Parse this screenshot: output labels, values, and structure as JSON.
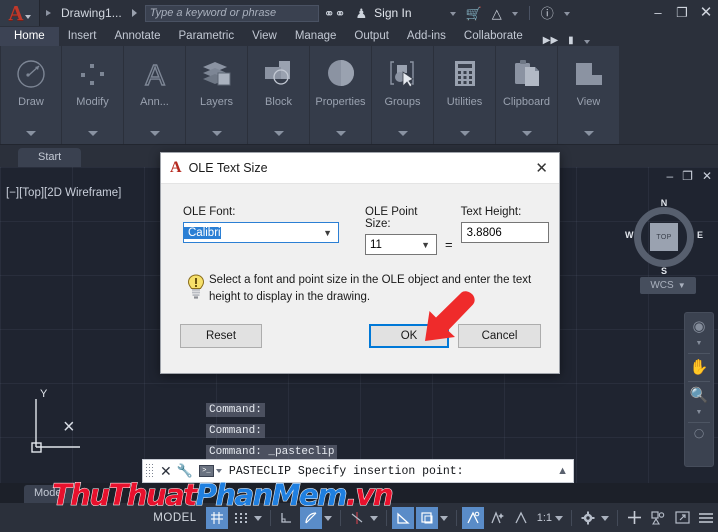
{
  "titlebar": {
    "app_logo": "autocad-a-logo",
    "document_title": "Drawing1...",
    "search_placeholder": "Type a keyword or phrase",
    "search_value": "",
    "search_icon": "binoculars-icon",
    "signin_label": "Sign In",
    "account_icon": "person-icon",
    "cart_icon": "shopping-cart-icon",
    "autodesk_icon": "autodesk-triangle-icon",
    "help_icon": "question-circle-icon",
    "minimize": "–",
    "maximize": "❐",
    "close": "✕"
  },
  "ribbon_tabs": [
    {
      "label": "Home",
      "active": true
    },
    {
      "label": "Insert",
      "active": false
    },
    {
      "label": "Annotate",
      "active": false
    },
    {
      "label": "Parametric",
      "active": false
    },
    {
      "label": "View",
      "active": false
    },
    {
      "label": "Manage",
      "active": false
    },
    {
      "label": "Output",
      "active": false
    },
    {
      "label": "Add-ins",
      "active": false
    },
    {
      "label": "Collaborate",
      "active": false
    }
  ],
  "ribbon_tabs_extra": {
    "overflow_icon": "double-chevron-right-icon",
    "panel_toggle_icon": "ribbon-minimize-icon",
    "panel_toggle_caret": "chevron-down-icon"
  },
  "ribbon_panels": [
    {
      "label": "Draw",
      "icon": "draw-arc-icon"
    },
    {
      "label": "Modify",
      "icon": "modify-dots-icon"
    },
    {
      "label": "Ann...",
      "icon": "annotation-a-icon"
    },
    {
      "label": "Layers",
      "icon": "layers-stack-icon"
    },
    {
      "label": "Block",
      "icon": "block-insert-icon"
    },
    {
      "label": "Properties",
      "icon": "properties-circle-icon"
    },
    {
      "label": "Groups",
      "icon": "groups-select-icon"
    },
    {
      "label": "Utilities",
      "icon": "utilities-calculator-icon"
    },
    {
      "label": "Clipboard",
      "icon": "clipboard-paste-icon"
    },
    {
      "label": "View",
      "icon": "view-window-icon"
    }
  ],
  "file_tabs": [
    {
      "label": "Start"
    }
  ],
  "viewport": {
    "label": "[−][Top][2D Wireframe]",
    "window_controls": {
      "minimize": "–",
      "restore": "❐",
      "close": "✕"
    },
    "viewcube": {
      "north": "N",
      "south": "S",
      "east": "E",
      "west": "W",
      "face": "TOP"
    },
    "wcs_label": "WCS",
    "wcs_caret": "chevron-down-icon",
    "navbar_icons": [
      "steering-wheel-icon",
      "pan-hand-icon",
      "zoom-extents-icon",
      "orbit-icon",
      "showmotion-icon"
    ],
    "ucs_y_label": "Y",
    "crosshair": "×"
  },
  "command_history": [
    "Command:",
    "Command:",
    "Command: _pasteclip"
  ],
  "command_bar": {
    "grip_icon": "drag-grip-icon",
    "close_icon": "close-icon",
    "customize_icon": "wrench-icon",
    "prompt_icon": "command-prompt-icon",
    "prompt_caret": "chevron-down-icon",
    "text": "PASTECLIP Specify insertion point:",
    "expand_icon": "chevron-up-icon"
  },
  "model_tab": {
    "label": "Model"
  },
  "statusbar": {
    "space_label": "MODEL",
    "scale_label": "1:1",
    "items": [
      {
        "name": "grid-display-toggle",
        "icon": "grid-icon",
        "on": true
      },
      {
        "name": "snap-mode-toggle",
        "icon": "snap-dots-icon",
        "on": false
      },
      {
        "name": "snap-mode-caret",
        "icon": "chevron-down-icon",
        "on": false
      },
      {
        "name": "ortho-mode-toggle",
        "icon": "ortho-corner-icon",
        "on": false
      },
      {
        "name": "polar-tracking-toggle",
        "icon": "polar-angle-icon",
        "on": true
      },
      {
        "name": "polar-tracking-caret",
        "icon": "chevron-down-icon",
        "on": false
      },
      {
        "name": "isometric-drafting-toggle",
        "icon": "isometric-icon",
        "on": false
      },
      {
        "name": "isometric-caret",
        "icon": "chevron-down-icon",
        "on": false
      },
      {
        "name": "object-snap-toggle",
        "icon": "osnap-angle-icon",
        "on": true
      },
      {
        "name": "object-snap-3d-toggle",
        "icon": "osnap-3d-icon",
        "on": true
      },
      {
        "name": "object-snap-caret",
        "icon": "chevron-down-icon",
        "on": false
      },
      {
        "name": "annotation-visibility",
        "icon": "annotation-scale-icon",
        "on": true
      },
      {
        "name": "autoscale-toggle",
        "icon": "autoscale-icon",
        "on": false
      },
      {
        "name": "annotation-monitor",
        "icon": "annotation-monitor-icon",
        "on": false
      },
      {
        "name": "workspace-switching",
        "icon": "gear-icon",
        "on": false
      },
      {
        "name": "workspace-caret",
        "icon": "chevron-down-icon",
        "on": false
      },
      {
        "name": "hardware-acceleration",
        "icon": "plus-icon",
        "on": false
      },
      {
        "name": "isolate-objects",
        "icon": "isolate-objects-icon",
        "on": false
      },
      {
        "name": "fullscreen-toggle",
        "icon": "fullscreen-icon",
        "on": false
      },
      {
        "name": "customization-menu",
        "icon": "hamburger-icon",
        "on": false
      }
    ]
  },
  "dialog": {
    "logo_icon": "autocad-a-logo",
    "title": "OLE Text Size",
    "close_icon": "✕",
    "font_label": "OLE Font:",
    "font_value": "Calibri",
    "font_caret": "chevron-down-icon",
    "point_size_label": "OLE Point Size:",
    "point_size_value": "11",
    "point_size_caret": "chevron-down-icon",
    "equals": "=",
    "text_height_label": "Text Height:",
    "text_height_value": "3.8806",
    "hint_icon": "lightbulb-icon",
    "hint_text": "Select a font and point size in the OLE object and enter the text height to display in the drawing.",
    "buttons": {
      "reset": "Reset",
      "ok": "OK",
      "cancel": "Cancel"
    }
  },
  "annotation": {
    "arrow_icon": "red-arrow-pointing-to-ok",
    "arrow_color": "#ef2b2b"
  },
  "watermark": {
    "part1": "ThuThuat",
    "part2": "PhanMem",
    "part3": ".vn",
    "color1": "#e8112d",
    "color2": "#1f7fe0"
  }
}
